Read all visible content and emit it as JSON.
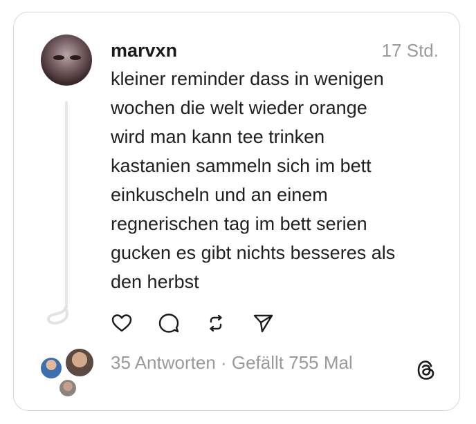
{
  "post": {
    "username": "marvxn",
    "time": "17 Std.",
    "lines": [
      "kleiner reminder dass in wenigen",
      "wochen die welt wieder orange",
      "wird man kann tee trinken",
      "kastanien sammeln sich im bett",
      "einkuscheln und an einem",
      "regnerischen tag im bett serien",
      "gucken es gibt nichts besseres als",
      "den herbst"
    ]
  },
  "actions": {
    "like_icon": "heart-icon",
    "reply_icon": "speech-bubble-icon",
    "repost_icon": "repost-icon",
    "share_icon": "send-icon"
  },
  "stats": {
    "text": "35 Antworten · Gefällt 755 Mal"
  },
  "brand": {
    "logo_icon": "threads-logo-icon"
  }
}
